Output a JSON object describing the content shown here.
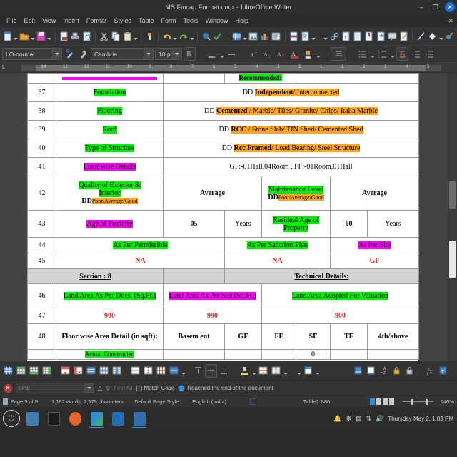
{
  "window": {
    "title": "MS Fincap Format.docx - LibreOffice Writer",
    "minimize": "–",
    "maximize": "❐",
    "close": "✕",
    "doc_close": "✕"
  },
  "menubar": {
    "items": [
      "File",
      "Edit",
      "View",
      "Insert",
      "Format",
      "Styles",
      "Table",
      "Form",
      "Tools",
      "Window",
      "Help"
    ]
  },
  "formatbar": {
    "paragraph_style": "LO-normal",
    "font_name": "Cambria",
    "font_size": "10 pt"
  },
  "ruler": {
    "ticks": [
      "14",
      "13",
      "12",
      "11",
      "10",
      "9",
      "8",
      "7",
      "6",
      "5",
      "4",
      "3",
      "2",
      "1",
      "1",
      "2",
      "3",
      "4",
      "5"
    ]
  },
  "document": {
    "clip_top": {
      "col2": "",
      "col4": "Recommended:"
    },
    "rows": [
      {
        "num": "37",
        "label": "Foundation",
        "label_hl": "green",
        "dd": "",
        "value": "Independent/ Interconnected",
        "value_bold_part": "Independent",
        "value_rest": "/ Interconnected",
        "value_hl": "orange",
        "prefix": "DD"
      },
      {
        "num": "38",
        "label": "Flooring",
        "label_hl": "green",
        "prefix": "DD",
        "value_bold_part": "Cemented",
        "value_rest": " / Marble/ Tiles/ Granite/ Chips/ Italia Marble",
        "value_hl": "orange"
      },
      {
        "num": "39",
        "label": "Roof",
        "label_hl": "green",
        "prefix": "DD",
        "value_bold_part": "RCC",
        "value_rest": " / Stone Slab/ TIN Shed/ Cemented Shed",
        "value_hl": "orange"
      },
      {
        "num": "40",
        "label": "Type of Structure",
        "label_hl": "green",
        "prefix": "DD",
        "value_bold_part": "Rcc Framed",
        "value_rest": "/ Load Bearing/ Steel Structure",
        "value_hl": "orange"
      },
      {
        "num": "41",
        "label": "Floor wise Details",
        "label_hl": "magenta",
        "prefix": "",
        "value_bold_part": "",
        "value_rest": "GF:-01Hall,04Room , FF:-01Room,01Hall",
        "value_hl": "none"
      }
    ],
    "row42": {
      "num": "42",
      "label_line1": "Quality of Exterior &",
      "label_line2": "Interior",
      "label_dd": "DD",
      "label_options": "Poor/Average/Good",
      "value1": "Average",
      "label2": "Maintenance Level",
      "label2_dd": "DD",
      "label2_options": "Poor/Average/Good",
      "value2": "Average"
    },
    "row43": {
      "num": "43",
      "label1": "Age of Property",
      "value1": "05",
      "unit1": "Years",
      "label2": "Residual Age of Property",
      "value2": "60",
      "unit2": "Years"
    },
    "row44": {
      "num": "44",
      "c1": "As Per Permissible",
      "c2": "As Per Sanction Plan",
      "c3": "As Per Site"
    },
    "row45": {
      "num": "45",
      "c1": "NA",
      "c2": "NA",
      "c3": "GF"
    },
    "section": {
      "left": "Section : 8",
      "right": "Technical Details:"
    },
    "row46": {
      "num": "46",
      "c1": "Land Area As Per Docs. (Sq.Ft.)",
      "c2": "Land Area As Per Site  (Sq.Ft.)",
      "c3": "Land Area Adopted For Valuation"
    },
    "row47": {
      "num": "47",
      "c1": "900",
      "c2": "990",
      "c3": "900"
    },
    "row48": {
      "num": "48",
      "label": "Floor wise Area Detail (in sqft):",
      "cols": [
        "Basem ent",
        "GF",
        "FF",
        "SF",
        "TF",
        "4th/above"
      ]
    },
    "clip_bottom": {
      "label": "Actual Constructed",
      "sf_value": "0"
    }
  },
  "findbar": {
    "close": "✕",
    "placeholder": "Find",
    "find_prev": "△",
    "find_next": "▽",
    "find_all": "Find All",
    "match_case": "Match Case",
    "message": "Reached the end of the document"
  },
  "statusbar": {
    "page": "Page 3 of 9",
    "words": "1,192 words, 7,579 characters",
    "page_style": "Default Page Style",
    "language": "English (India)",
    "table_cell": "Table1:B86",
    "zoom": "140%"
  },
  "taskbar": {
    "clock": "Thursday May 2, 1:03 PM"
  },
  "colors": {
    "highlight_green": "#00ee00",
    "highlight_magenta": "#ff00ff",
    "highlight_orange": "#ffa520",
    "red_text": "#e03030",
    "accent": "#1b6fd8"
  }
}
